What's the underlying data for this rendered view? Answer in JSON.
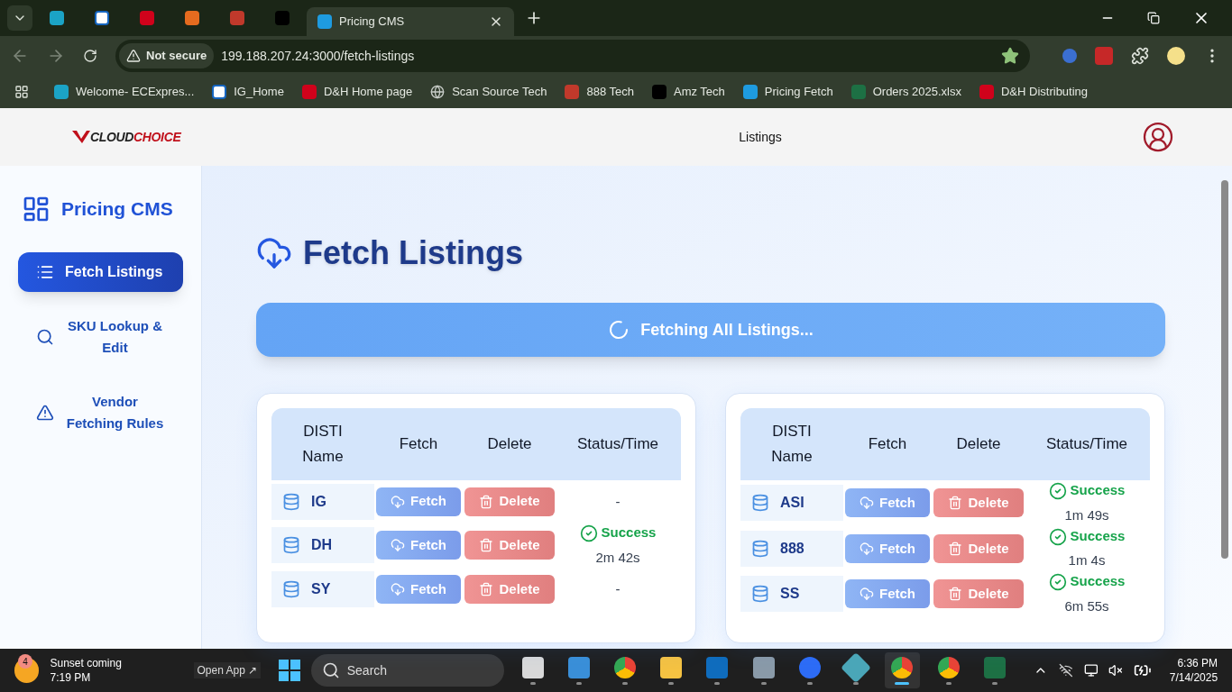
{
  "browser": {
    "tabs": [
      {
        "kind": "ec",
        "selected": false
      },
      {
        "kind": "g",
        "selected": false
      },
      {
        "kind": "dh",
        "selected": false
      },
      {
        "kind": "box",
        "selected": false
      },
      {
        "kind": "knot",
        "selected": false
      },
      {
        "kind": "amazon",
        "selected": false
      },
      {
        "kind": "dollar",
        "label": "Pricing CMS",
        "selected": true
      }
    ],
    "security": "Not secure",
    "url": "199.188.207.24:3000/fetch-listings",
    "bookmarks": [
      {
        "kind": "ec",
        "label": "Welcome- ECExpres..."
      },
      {
        "kind": "g",
        "label": "IG_Home"
      },
      {
        "kind": "dh",
        "label": "D&H Home page"
      },
      {
        "kind": "globe",
        "label": "Scan Source Tech"
      },
      {
        "kind": "knot",
        "label": "888 Tech"
      },
      {
        "kind": "amazon",
        "label": "Amz Tech"
      },
      {
        "kind": "dollar",
        "label": "Pricing Fetch"
      },
      {
        "kind": "excel",
        "label": "Orders 2025.xlsx"
      },
      {
        "kind": "dh",
        "label": "D&H Distributing"
      }
    ]
  },
  "header": {
    "logo_dark": "CLOUD",
    "logo_red": "CHOICE",
    "nav": "Listings"
  },
  "sidebar": {
    "title": "Pricing CMS",
    "items": [
      {
        "kind": "list",
        "label": "Fetch Listings",
        "selected": true
      },
      {
        "kind": "search",
        "label": "SKU Lookup & Edit",
        "selected": false
      },
      {
        "kind": "alert",
        "label": "Vendor Fetching Rules",
        "selected": false
      }
    ]
  },
  "main": {
    "title": "Fetch Listings",
    "banner": "Fetching All Listings...",
    "tables": [
      {
        "columns": [
          "DISTI Name",
          "Fetch",
          "Delete",
          "Status/Time"
        ],
        "rows": [
          {
            "name": "IG",
            "fetch": "Fetch",
            "delete": "Delete",
            "success": false,
            "status_text": "-"
          },
          {
            "name": "DH",
            "fetch": "Fetch",
            "delete": "Delete",
            "success": true,
            "status_text": "Success",
            "time": "2m 42s"
          },
          {
            "name": "SY",
            "fetch": "Fetch",
            "delete": "Delete",
            "success": false,
            "status_text": "-"
          }
        ]
      },
      {
        "columns": [
          "DISTI Name",
          "Fetch",
          "Delete",
          "Status/Time"
        ],
        "rows": [
          {
            "name": "ASI",
            "fetch": "Fetch",
            "delete": "Delete",
            "success": true,
            "status_text": "Success",
            "time": "1m 49s"
          },
          {
            "name": "888",
            "fetch": "Fetch",
            "delete": "Delete",
            "success": true,
            "status_text": "Success",
            "time": "1m 4s"
          },
          {
            "name": "SS",
            "fetch": "Fetch",
            "delete": "Delete",
            "success": true,
            "status_text": "Success",
            "time": "6m 55s"
          }
        ]
      }
    ]
  },
  "taskbar": {
    "weather_badge": "4",
    "weather_title": "Sunset coming",
    "weather_time": "7:19 PM",
    "open_app": "Open App ↗",
    "search": "Search",
    "apps": [
      {
        "kind": "taskview",
        "active": false
      },
      {
        "kind": "store",
        "active": false
      },
      {
        "kind": "chrome",
        "active": false
      },
      {
        "kind": "folder",
        "active": false
      },
      {
        "kind": "outlook",
        "active": false
      },
      {
        "kind": "calc",
        "active": false
      },
      {
        "kind": "zoom",
        "active": false
      },
      {
        "kind": "gem",
        "active": false
      },
      {
        "kind": "chrome",
        "active": true
      },
      {
        "kind": "chrome",
        "active": false
      },
      {
        "kind": "excel",
        "active": false
      }
    ],
    "time": "6:36 PM",
    "date": "7/14/2025"
  }
}
